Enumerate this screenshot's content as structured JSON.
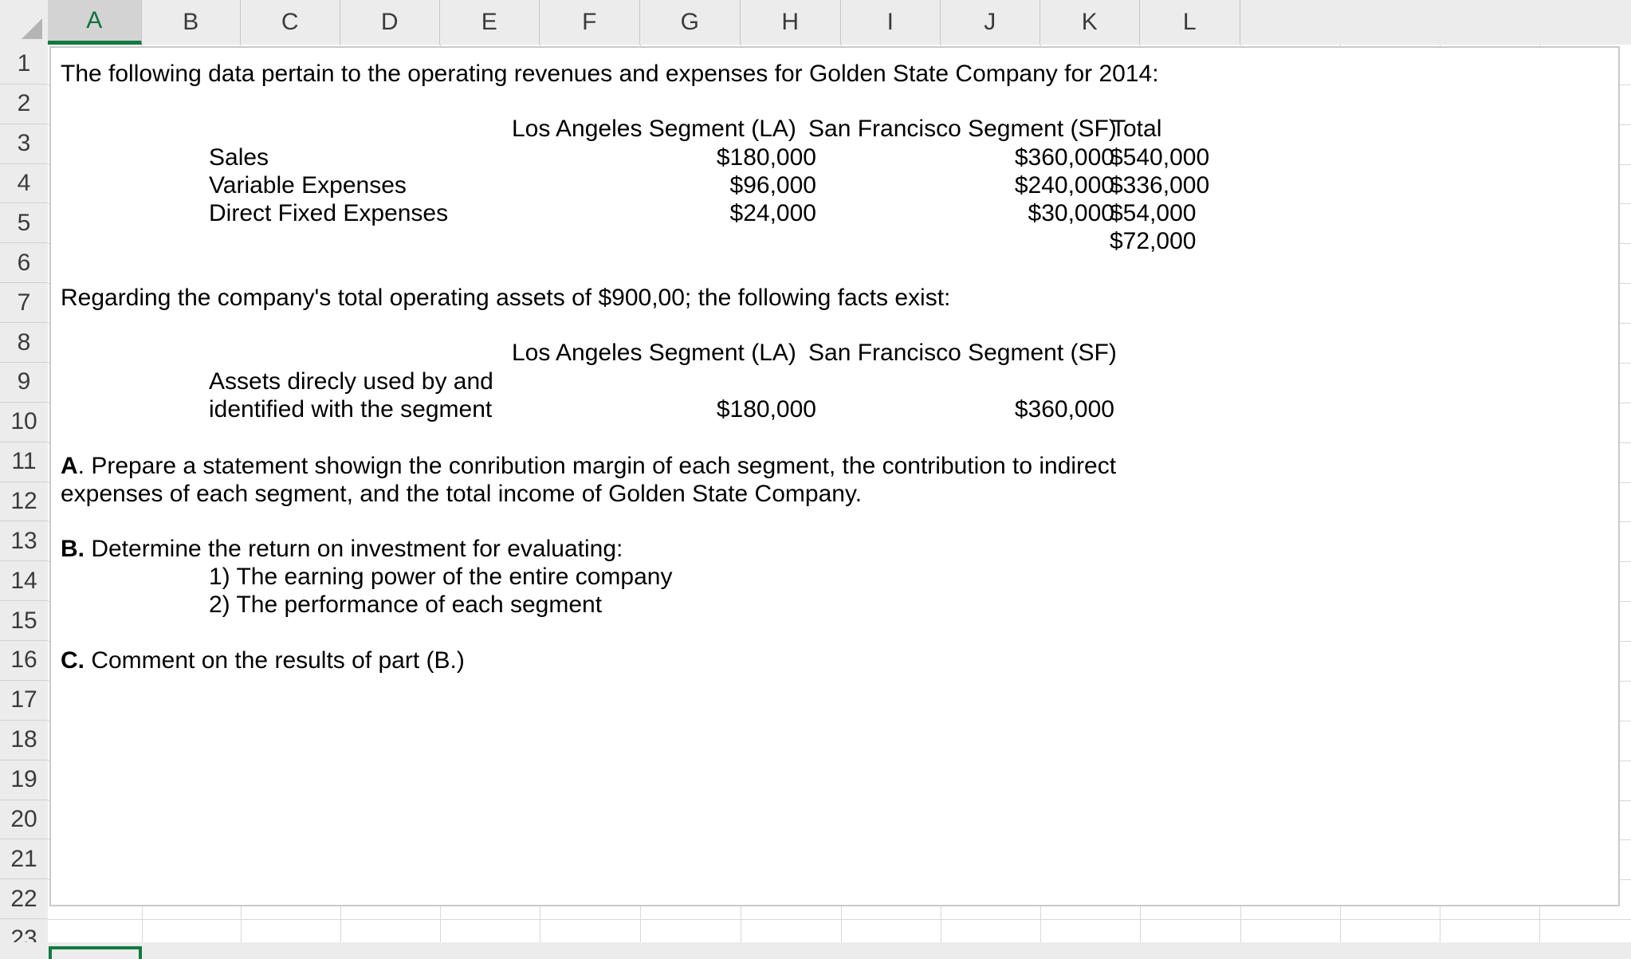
{
  "app": {
    "type": "spreadsheet",
    "selected_column": "A",
    "active_cell": "A23"
  },
  "grid": {
    "columns": [
      "A",
      "B",
      "C",
      "D",
      "E",
      "F",
      "G",
      "H",
      "I",
      "J",
      "K",
      "L"
    ],
    "rows": [
      "1",
      "2",
      "3",
      "4",
      "5",
      "6",
      "7",
      "8",
      "9",
      "10",
      "11",
      "12",
      "13",
      "14",
      "15",
      "16",
      "17",
      "18",
      "19",
      "20",
      "21",
      "22",
      "23"
    ]
  },
  "colors": {
    "header_bg": "#ececec",
    "header_selected_bg": "#d3d3d3",
    "accent_green": "#13783f",
    "gridline": "#d8d8d8",
    "text": "#000000"
  },
  "content": {
    "intro": "The following data pertain to the operating revenues and expenses for Golden State Company for 2014:",
    "table1": {
      "headers": {
        "la": "Los Angeles Segment (LA)",
        "sf": "San Francisco Segment (SF)",
        "total": "Total"
      },
      "rows": [
        {
          "label": "Sales",
          "la": "$180,000",
          "sf": "$360,000",
          "total": "$540,000"
        },
        {
          "label": "Variable Expenses",
          "la": "$96,000",
          "sf": "$240,000",
          "total": "$336,000"
        },
        {
          "label": "Direct Fixed Expenses",
          "la": "$24,000",
          "sf": "$30,000",
          "total": "$54,000"
        }
      ],
      "extra_total": "$72,000"
    },
    "assets_intro": "Regarding the company's total operating assets of $900,00; the following facts exist:",
    "table2": {
      "headers": {
        "la": "Los Angeles Segment (LA)",
        "sf": "San Francisco Segment (SF)"
      },
      "row": {
        "label_line1": "Assets direcly used by and",
        "label_line2": "identified with the segment",
        "la": "$180,000",
        "sf": "$360,000"
      }
    },
    "questions": {
      "a": {
        "marker": "A",
        "text": ". Prepare a statement showign the conribution margin of each segment, the contribution to indirect expenses of each segment, and the total income of Golden State Company."
      },
      "b": {
        "marker": "B.",
        "text": " Determine the return on investment for evaluating:",
        "items": [
          "1) The earning power of the entire company",
          "2) The performance of each segment"
        ]
      },
      "c": {
        "marker": "C.",
        "text": " Comment on the results of part (B.)"
      }
    }
  }
}
